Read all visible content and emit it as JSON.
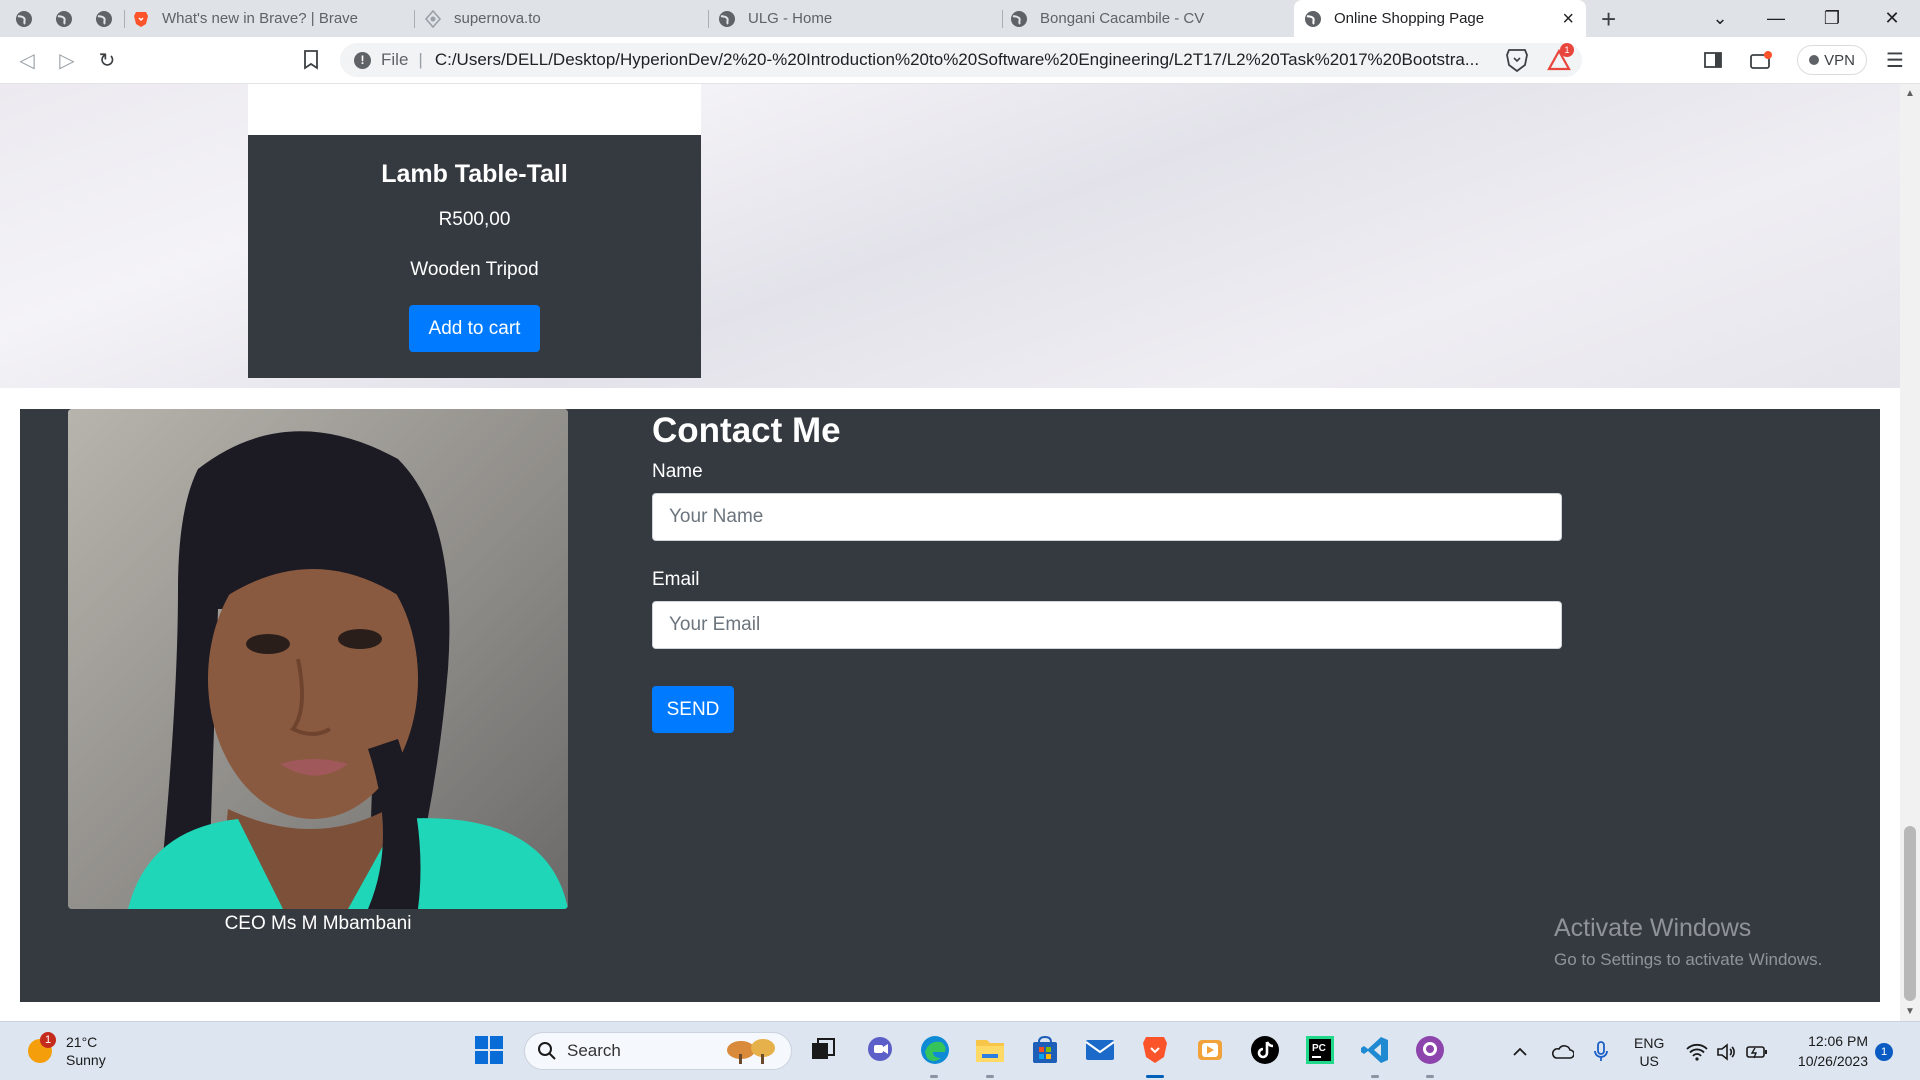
{
  "browser": {
    "tabs": [
      {
        "label": "What's new in Brave? | Brave"
      },
      {
        "label": "supernova.to"
      },
      {
        "label": "ULG - Home"
      },
      {
        "label": "Bongani Cacambile - CV"
      },
      {
        "label": "Online Shopping Page",
        "active": true
      }
    ],
    "address": {
      "file_label": "File",
      "url": "C:/Users/DELL/Desktop/HyperionDev/2%20-%20Introduction%20to%20Software%20Engineering/L2T17/L2%20Task%2017%20Bootstra..."
    },
    "vpn_label": "VPN",
    "rewards_badge": "1"
  },
  "product": {
    "title": "Lamb Table-Tall",
    "price": "R500,00",
    "description": "Wooden Tripod",
    "button_label": "Add to cart"
  },
  "contact": {
    "heading": "Contact Me",
    "caption": "CEO Ms M Mbambani",
    "name_label": "Name",
    "name_placeholder": "Your Name",
    "email_label": "Email",
    "email_placeholder": "Your Email",
    "send_label": "SEND"
  },
  "watermark": {
    "title": "Activate Windows",
    "subtitle": "Go to Settings to activate Windows."
  },
  "taskbar": {
    "weather_temp": "21°C",
    "weather_desc": "Sunny",
    "weather_badge": "1",
    "search_label": "Search",
    "lang_line1": "ENG",
    "lang_line2": "US",
    "time": "12:06 PM",
    "date": "10/26/2023",
    "notification_count": "1"
  },
  "colors": {
    "primary": "#007bff",
    "dark": "#343a40",
    "page_bg": "#ebeaf0"
  }
}
